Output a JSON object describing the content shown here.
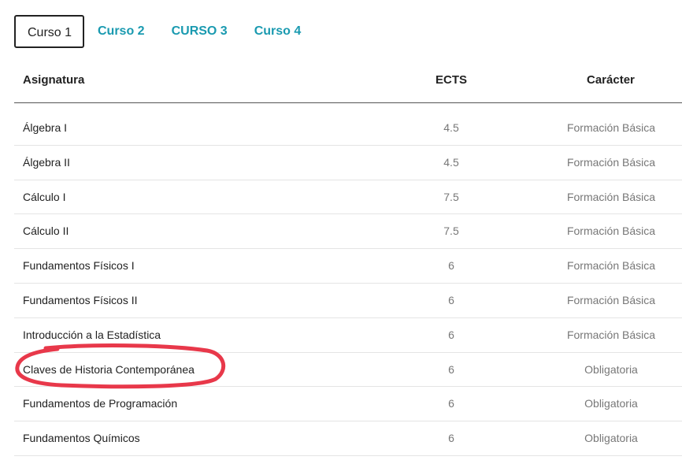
{
  "tabs": [
    {
      "label": "Curso 1",
      "active": true
    },
    {
      "label": "Curso 2",
      "active": false
    },
    {
      "label": "CURSO 3",
      "active": false
    },
    {
      "label": "Curso 4",
      "active": false
    }
  ],
  "table": {
    "headers": {
      "subject": "Asignatura",
      "ects": "ECTS",
      "type": "Carácter"
    },
    "rows": [
      {
        "subject": "Álgebra I",
        "ects": "4.5",
        "type": "Formación Básica"
      },
      {
        "subject": "Álgebra II",
        "ects": "4.5",
        "type": "Formación Básica"
      },
      {
        "subject": "Cálculo I",
        "ects": "7.5",
        "type": "Formación Básica"
      },
      {
        "subject": "Cálculo II",
        "ects": "7.5",
        "type": "Formación Básica"
      },
      {
        "subject": "Fundamentos Físicos I",
        "ects": "6",
        "type": "Formación Básica"
      },
      {
        "subject": "Fundamentos Físicos II",
        "ects": "6",
        "type": "Formación Básica"
      },
      {
        "subject": "Introducción a la Estadística",
        "ects": "6",
        "type": "Formación Básica"
      },
      {
        "subject": "Claves de Historia Contemporánea",
        "ects": "6",
        "type": "Obligatoria"
      },
      {
        "subject": "Fundamentos de Programación",
        "ects": "6",
        "type": "Obligatoria"
      },
      {
        "subject": "Fundamentos Químicos",
        "ects": "6",
        "type": "Obligatoria"
      }
    ]
  },
  "colors": {
    "tab_link": "#1a9ab0",
    "annotation": "#e8384a"
  }
}
